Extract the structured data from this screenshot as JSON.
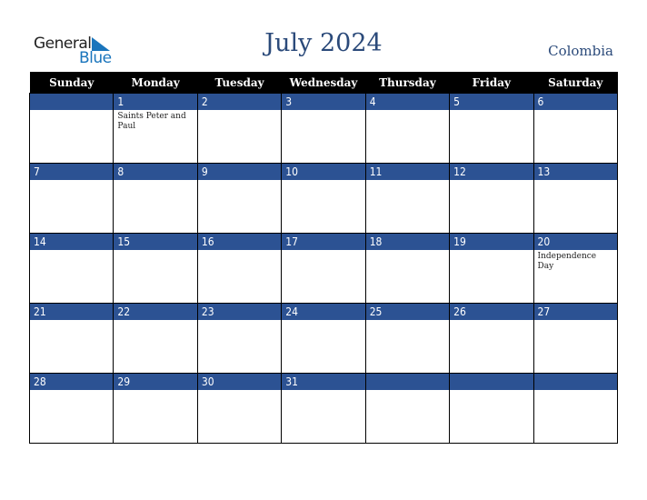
{
  "logo": {
    "line1": "General",
    "line2": "Blue"
  },
  "title": "July 2024",
  "country": "Colombia",
  "colors": {
    "header_bg": "#000000",
    "daybar_bg": "#2c5293",
    "title": "#2b4a7a",
    "logo_blue": "#1a75bc"
  },
  "weekdays": [
    "Sunday",
    "Monday",
    "Tuesday",
    "Wednesday",
    "Thursday",
    "Friday",
    "Saturday"
  ],
  "weeks": [
    [
      {
        "day": ""
      },
      {
        "day": "1",
        "event": "Saints Peter and Paul"
      },
      {
        "day": "2"
      },
      {
        "day": "3"
      },
      {
        "day": "4"
      },
      {
        "day": "5"
      },
      {
        "day": "6"
      }
    ],
    [
      {
        "day": "7"
      },
      {
        "day": "8"
      },
      {
        "day": "9"
      },
      {
        "day": "10"
      },
      {
        "day": "11"
      },
      {
        "day": "12"
      },
      {
        "day": "13"
      }
    ],
    [
      {
        "day": "14"
      },
      {
        "day": "15"
      },
      {
        "day": "16"
      },
      {
        "day": "17"
      },
      {
        "day": "18"
      },
      {
        "day": "19"
      },
      {
        "day": "20",
        "event": "Independence Day"
      }
    ],
    [
      {
        "day": "21"
      },
      {
        "day": "22"
      },
      {
        "day": "23"
      },
      {
        "day": "24"
      },
      {
        "day": "25"
      },
      {
        "day": "26"
      },
      {
        "day": "27"
      }
    ],
    [
      {
        "day": "28"
      },
      {
        "day": "29"
      },
      {
        "day": "30"
      },
      {
        "day": "31"
      },
      {
        "day": ""
      },
      {
        "day": ""
      },
      {
        "day": ""
      }
    ]
  ]
}
